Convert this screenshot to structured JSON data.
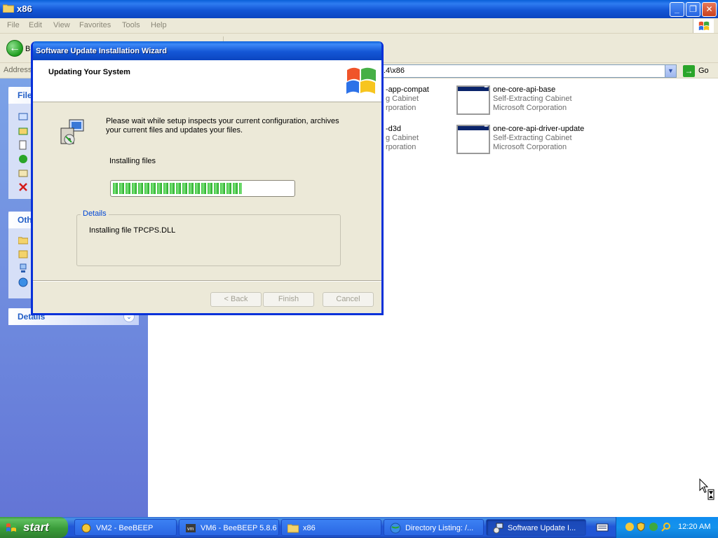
{
  "explorer": {
    "title": "x86",
    "menu": [
      "File",
      "Edit",
      "View",
      "Favorites",
      "Tools",
      "Help"
    ],
    "back_label": "B",
    "address_label": "Address",
    "address_value": ".4\\x86",
    "go_label": "Go",
    "taskpane": {
      "file_tasks_head": "File",
      "other_places_head": "Oth",
      "details_head": "Details"
    },
    "files": [
      {
        "name": "one-core-api-base",
        "type": "Self-Extracting Cabinet",
        "company": "Microsoft Corporation"
      },
      {
        "name": "one-core-api-driver-update",
        "type": "Self-Extracting Cabinet",
        "company": "Microsoft Corporation"
      }
    ],
    "partial_files": [
      {
        "name": "-app-compat",
        "type": "g Cabinet",
        "company": "rporation"
      },
      {
        "name": "-d3d",
        "type": "g Cabinet",
        "company": "rporation"
      }
    ]
  },
  "wizard": {
    "title": "Software Update Installation Wizard",
    "heading": "Updating Your System",
    "description": "Please wait while setup inspects your current configuration, archives your current files and updates your files.",
    "status": "Installing files",
    "progress": 0.72,
    "details_label": "Details",
    "details_text": "Installing file TPCPS.DLL",
    "buttons": {
      "back": "< Back",
      "finish": "Finish",
      "cancel": "Cancel"
    }
  },
  "taskbar": {
    "start_label": "start",
    "tasks": [
      {
        "label": "VM2 - BeeBEEP"
      },
      {
        "label": "VM6 - BeeBEEP 5.8.6"
      },
      {
        "label": "x86"
      },
      {
        "label": "Directory Listing: /..."
      },
      {
        "label": "Software Update I..."
      }
    ],
    "clock": "12:20 AM"
  }
}
